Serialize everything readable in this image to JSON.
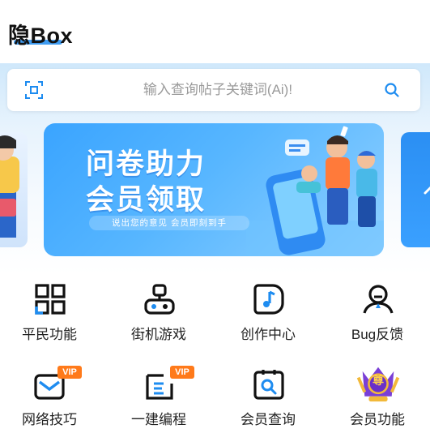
{
  "header": {
    "app_title": "隐Box"
  },
  "search": {
    "placeholder": "输入查询帖子关键词(Ai)!"
  },
  "banner": {
    "title_line1": "问卷助力",
    "title_line2": "会员领取",
    "subtitle": "说出您的意见 会员即刻到手"
  },
  "grid": {
    "row1": [
      {
        "label": "平民功能"
      },
      {
        "label": "街机游戏"
      },
      {
        "label": "创作中心"
      },
      {
        "label": "Bug反馈"
      }
    ],
    "row2": [
      {
        "label": "网络技巧",
        "badge": "VIP"
      },
      {
        "label": "一建编程",
        "badge": "VIP"
      },
      {
        "label": "会员查询"
      },
      {
        "label": "会员功能",
        "emblem": "尊"
      }
    ]
  },
  "colors": {
    "accent": "#1e8cf0",
    "vip_badge": "#ff7a1a",
    "icon_dark": "#111111"
  }
}
